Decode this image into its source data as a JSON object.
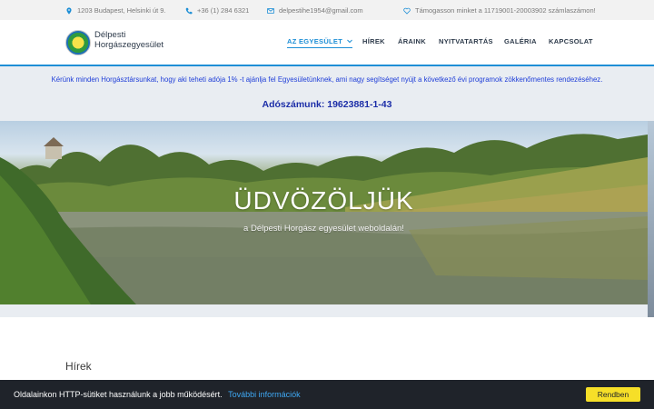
{
  "topbar": {
    "address": "1203 Budapest, Helsinki út 9.",
    "phone": "+36 (1) 284 6321",
    "email": "delpestihe1954@gmail.com",
    "support": "Támogasson minket a 11719001-20003902 számlaszámon!",
    "icon_color": "#1e8fd6"
  },
  "brand": {
    "line1": "Délpesti",
    "line2": "Horgászegyesület"
  },
  "nav": {
    "items": [
      {
        "label": "AZ EGYESÜLET",
        "active": true,
        "has_dropdown": true
      },
      {
        "label": "HÍREK"
      },
      {
        "label": "ÁRAINK"
      },
      {
        "label": "NYITVATARTÁS"
      },
      {
        "label": "GALÉRIA"
      },
      {
        "label": "KAPCSOLAT"
      }
    ],
    "accent": "#1e8fd6"
  },
  "notice": {
    "text": "Kérünk minden Horgásztársunkat, hogy aki teheti adója 1% -t ajánlja fel Egyesületünknek, ami nagy segítséget nyújt a következő évi programok zökkenőmentes rendezéséhez.",
    "tax_id": "Adószámunk: 19623881-1-43"
  },
  "hero": {
    "title": "ÜDVÖZÖLJÜK",
    "subtitle": "a Délpesti Horgász egyesület weboldalán!"
  },
  "content": {
    "section_title": "Hírek"
  },
  "cookie": {
    "text": "Oldalainkon HTTP-sütiket használunk a jobb működésért.",
    "link": "További információk",
    "button": "Rendben"
  }
}
